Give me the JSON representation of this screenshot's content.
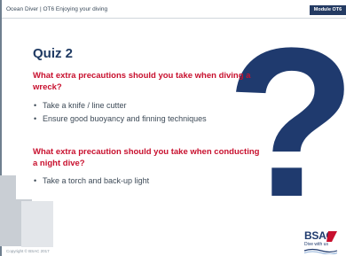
{
  "header": {
    "course": "Ocean Diver",
    "separator": "|",
    "lesson": "OT6 Enjoying your diving",
    "module_tag": "Module OT6"
  },
  "title": "Quiz 2",
  "question1": "What extra precautions should you take when diving a wreck?",
  "answers1": [
    "Take a knife / line cutter",
    "Ensure good buoyancy and finning techniques"
  ],
  "question2": "What extra precaution should you take when conducting a night dive?",
  "answers2": [
    "Take a torch and back-up light"
  ],
  "bullet": "•",
  "question_mark": "?",
  "footer": {
    "copyright": "Copyright © BSAC 2017"
  },
  "logo": {
    "brand": "BSAC",
    "tagline": "Dive with us"
  },
  "colors": {
    "navy": "#1f3a6e",
    "red": "#c8102e",
    "text": "#3d4a57"
  }
}
